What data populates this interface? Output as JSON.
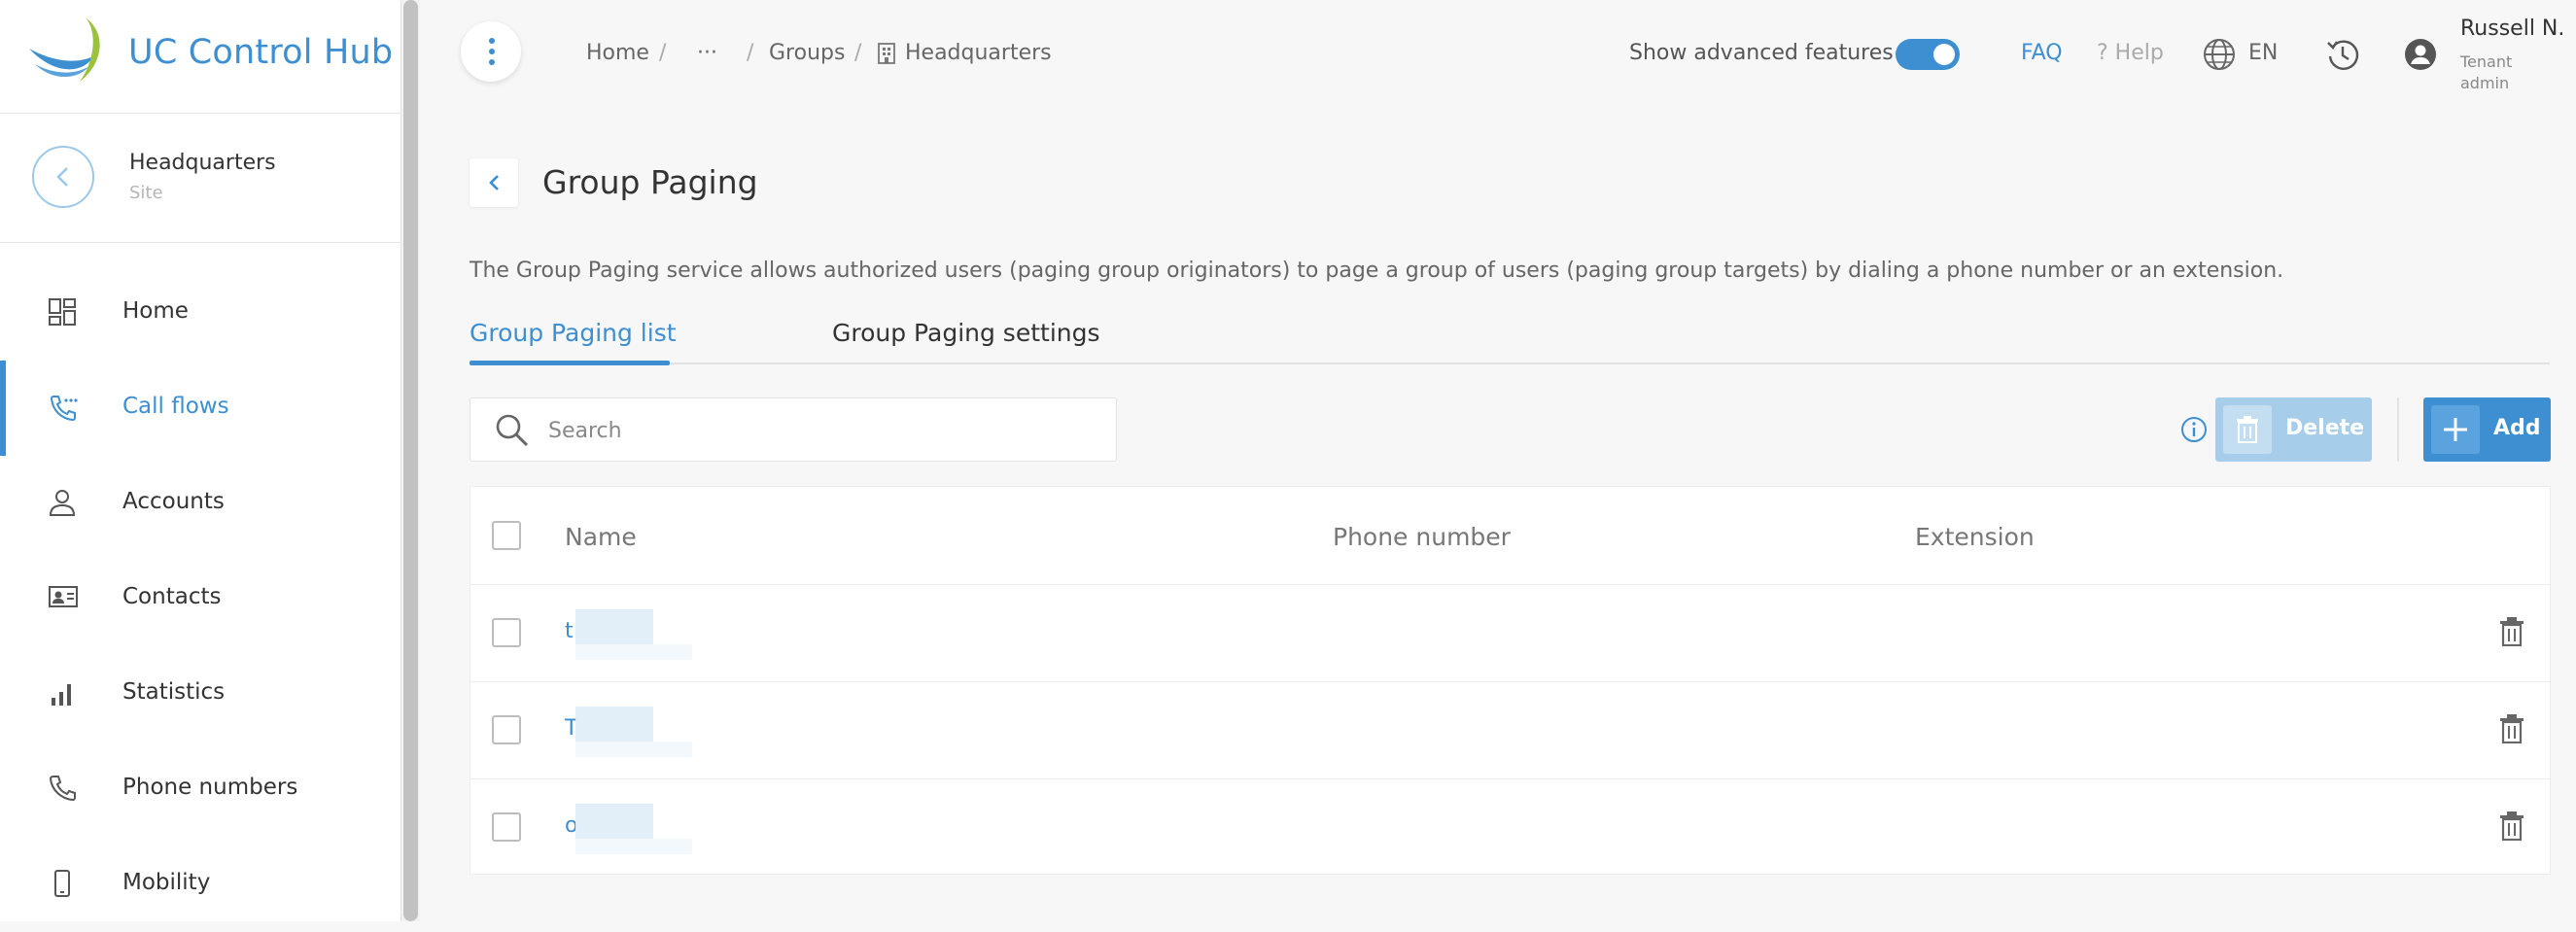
{
  "app": {
    "title": "UC Control Hub"
  },
  "context": {
    "title": "Headquarters",
    "subtitle": "Site"
  },
  "sidebar": {
    "items": [
      {
        "label": "Home",
        "icon": "dashboard-icon",
        "active": false
      },
      {
        "label": "Call flows",
        "icon": "call-flow-icon",
        "active": true
      },
      {
        "label": "Accounts",
        "icon": "person-icon",
        "active": false
      },
      {
        "label": "Contacts",
        "icon": "contact-card-icon",
        "active": false
      },
      {
        "label": "Statistics",
        "icon": "signal-bars-icon",
        "active": false
      },
      {
        "label": "Phone numbers",
        "icon": "phone-icon",
        "active": false
      },
      {
        "label": "Mobility",
        "icon": "mobile-icon",
        "active": false
      }
    ]
  },
  "breadcrumb": {
    "items": [
      "Home",
      "···",
      "Groups",
      "Headquarters"
    ],
    "separator": "/"
  },
  "header": {
    "advanced_label": "Show advanced features",
    "advanced_enabled": true,
    "faq": "FAQ",
    "help": "? Help",
    "language": "EN",
    "user": {
      "name": "Russell N.",
      "role_line1": "Tenant",
      "role_line2": "admin"
    }
  },
  "page": {
    "title": "Group Paging",
    "description": "The Group Paging service allows authorized users (paging group originators) to page a group of users (paging group targets) by dialing a phone number or an extension.",
    "tabs": [
      {
        "label": "Group Paging list",
        "active": true
      },
      {
        "label": "Group Paging settings",
        "active": false
      }
    ]
  },
  "toolbar": {
    "search_placeholder": "Search",
    "delete_label": "Delete",
    "add_label": "Add"
  },
  "table": {
    "columns": [
      "Name",
      "Phone number",
      "Extension"
    ],
    "rows": [
      {
        "name": "t",
        "phone": "",
        "extension": ""
      },
      {
        "name": "T",
        "phone": "",
        "extension": ""
      },
      {
        "name": "o",
        "phone": "",
        "extension": ""
      }
    ]
  },
  "colors": {
    "accent": "#3d8fd1",
    "disabled_button": "#a6cdea",
    "background": "#f7f7f7"
  }
}
